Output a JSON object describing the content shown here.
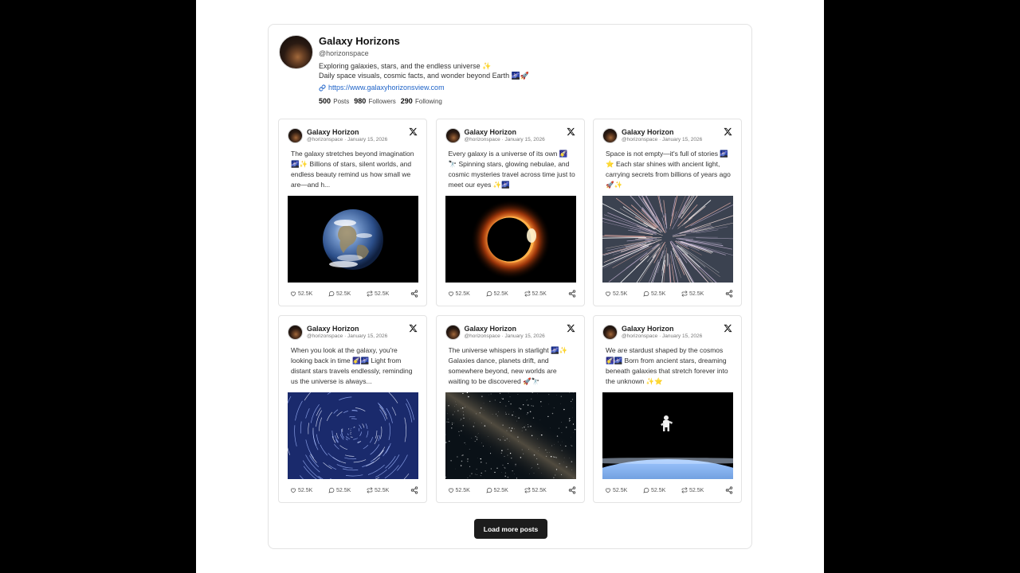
{
  "profile": {
    "name": "Galaxy Horizons",
    "handle": "@horizonspace",
    "bio_line1": "Exploring galaxies, stars, and the endless universe ✨",
    "bio_line2": "Daily space visuals, cosmic facts, and wonder beyond Earth 🌌🚀",
    "link": "https://www.galaxyhorizonsview.com",
    "stats": {
      "posts_count": "500",
      "posts_label": "Posts",
      "followers_count": "980",
      "followers_label": "Followers",
      "following_count": "290",
      "following_label": "Following"
    }
  },
  "posts": [
    {
      "author": "Galaxy Horizon",
      "meta": "@horizonspace · January 15, 2026",
      "text": "The galaxy stretches beyond imagination 🌌✨ Billions of stars, silent worlds, and endless beauty remind us how small we are—and h...",
      "image": "earth",
      "likes": "52.5K",
      "replies": "52.5K",
      "reposts": "52.5K"
    },
    {
      "author": "Galaxy Horizon",
      "meta": "@horizonspace · January 15, 2026",
      "text": "Every galaxy is a universe of its own 🌠🔭 Spinning stars, glowing nebulae, and cosmic mysteries travel across time just to meet our eyes ✨🌌",
      "image": "eclipse",
      "likes": "52.5K",
      "replies": "52.5K",
      "reposts": "52.5K"
    },
    {
      "author": "Galaxy Horizon",
      "meta": "@horizonspace · January 15, 2026",
      "text": "Space is not empty—it's full of stories 🌌⭐ Each star shines with ancient light, carrying secrets from billions of years ago 🚀✨",
      "image": "warp",
      "likes": "52.5K",
      "replies": "52.5K",
      "reposts": "52.5K"
    },
    {
      "author": "Galaxy Horizon",
      "meta": "@horizonspace · January 15, 2026",
      "text": "When you look at the galaxy, you're looking back in time 🌠🌌 Light from distant stars travels endlessly, reminding us the universe is always...",
      "image": "startrails",
      "likes": "52.5K",
      "replies": "52.5K",
      "reposts": "52.5K"
    },
    {
      "author": "Galaxy Horizon",
      "meta": "@horizonspace · January 15, 2026",
      "text": "The universe whispers in starlight 🌌✨ Galaxies dance, planets drift, and somewhere beyond, new worlds are waiting to be discovered 🚀🔭",
      "image": "milkyway",
      "likes": "52.5K",
      "replies": "52.5K",
      "reposts": "52.5K"
    },
    {
      "author": "Galaxy Horizon",
      "meta": "@horizonspace · January 15, 2026",
      "text": "We are stardust shaped by the cosmos 🌠🌌 Born from ancient stars, dreaming beneath galaxies that stretch forever into the unknown ✨⭐",
      "image": "astronaut",
      "likes": "52.5K",
      "replies": "52.5K",
      "reposts": "52.5K"
    }
  ],
  "load_more_label": "Load more posts"
}
